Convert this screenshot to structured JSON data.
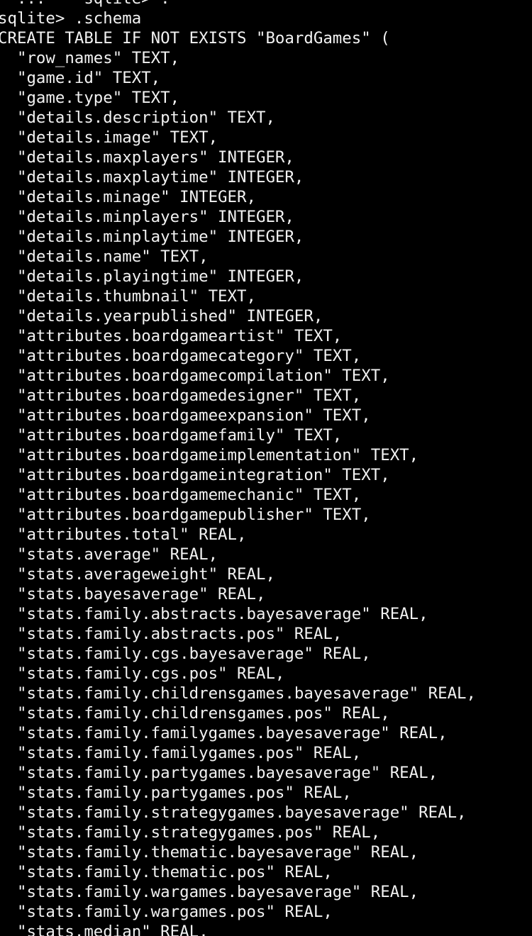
{
  "terminal": {
    "colors": {
      "background": "#000000",
      "text": "#f2f2f2"
    },
    "lines": [
      "  ...    sqlite> .",
      "sqlite> .schema",
      "CREATE TABLE IF NOT EXISTS \"BoardGames\" (",
      "  \"row_names\" TEXT,",
      "  \"game.id\" TEXT,",
      "  \"game.type\" TEXT,",
      "  \"details.description\" TEXT,",
      "  \"details.image\" TEXT,",
      "  \"details.maxplayers\" INTEGER,",
      "  \"details.maxplaytime\" INTEGER,",
      "  \"details.minage\" INTEGER,",
      "  \"details.minplayers\" INTEGER,",
      "  \"details.minplaytime\" INTEGER,",
      "  \"details.name\" TEXT,",
      "  \"details.playingtime\" INTEGER,",
      "  \"details.thumbnail\" TEXT,",
      "  \"details.yearpublished\" INTEGER,",
      "  \"attributes.boardgameartist\" TEXT,",
      "  \"attributes.boardgamecategory\" TEXT,",
      "  \"attributes.boardgamecompilation\" TEXT,",
      "  \"attributes.boardgamedesigner\" TEXT,",
      "  \"attributes.boardgameexpansion\" TEXT,",
      "  \"attributes.boardgamefamily\" TEXT,",
      "  \"attributes.boardgameimplementation\" TEXT,",
      "  \"attributes.boardgameintegration\" TEXT,",
      "  \"attributes.boardgamemechanic\" TEXT,",
      "  \"attributes.boardgamepublisher\" TEXT,",
      "  \"attributes.total\" REAL,",
      "  \"stats.average\" REAL,",
      "  \"stats.averageweight\" REAL,",
      "  \"stats.bayesaverage\" REAL,",
      "  \"stats.family.abstracts.bayesaverage\" REAL,",
      "  \"stats.family.abstracts.pos\" REAL,",
      "  \"stats.family.cgs.bayesaverage\" REAL,",
      "  \"stats.family.cgs.pos\" REAL,",
      "  \"stats.family.childrensgames.bayesaverage\" REAL,",
      "  \"stats.family.childrensgames.pos\" REAL,",
      "  \"stats.family.familygames.bayesaverage\" REAL,",
      "  \"stats.family.familygames.pos\" REAL,",
      "  \"stats.family.partygames.bayesaverage\" REAL,",
      "  \"stats.family.partygames.pos\" REAL,",
      "  \"stats.family.strategygames.bayesaverage\" REAL,",
      "  \"stats.family.strategygames.pos\" REAL,",
      "  \"stats.family.thematic.bayesaverage\" REAL,",
      "  \"stats.family.thematic.pos\" REAL,",
      "  \"stats.family.wargames.bayesaverage\" REAL,",
      "  \"stats.family.wargames.pos\" REAL,",
      "  \"stats.median\" REAL,"
    ]
  }
}
